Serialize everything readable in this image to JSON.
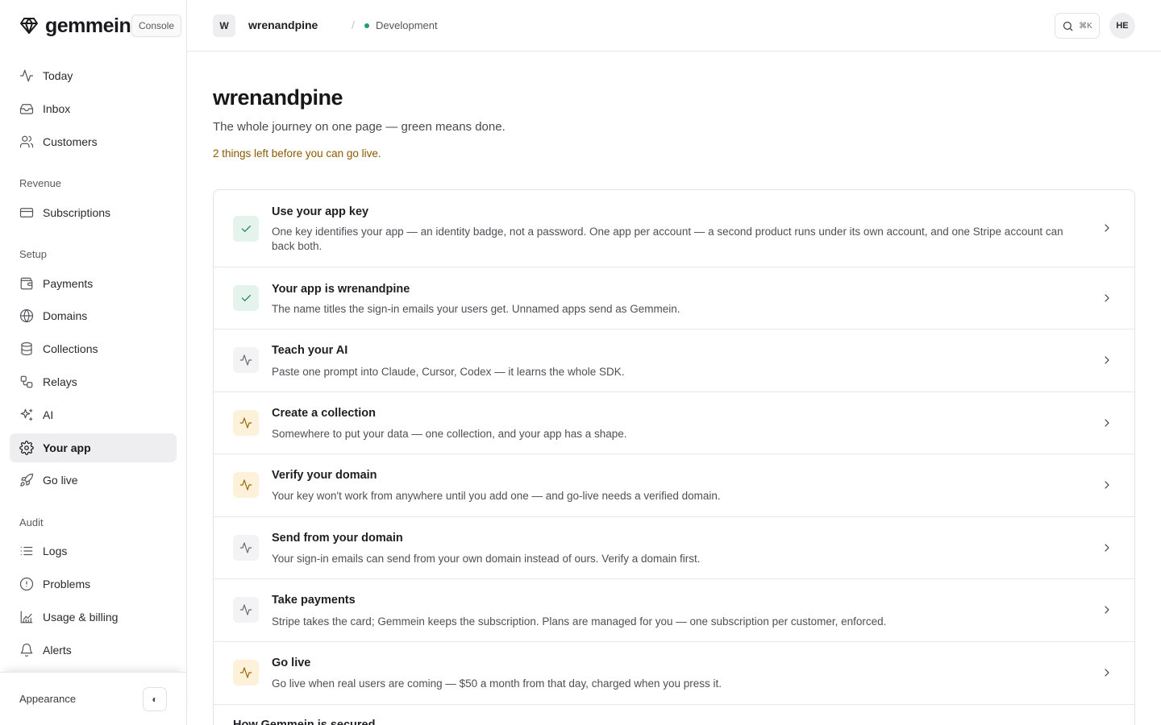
{
  "brand": {
    "name": "gemmein",
    "console_label": "Console"
  },
  "sidebar": {
    "primary": [
      {
        "label": "Today",
        "icon": "activity-icon"
      },
      {
        "label": "Inbox",
        "icon": "inbox-icon"
      },
      {
        "label": "Customers",
        "icon": "users-icon"
      }
    ],
    "sections": [
      {
        "label": "Revenue",
        "items": [
          {
            "label": "Subscriptions",
            "icon": "credit-card-icon"
          }
        ]
      },
      {
        "label": "Setup",
        "items": [
          {
            "label": "Payments",
            "icon": "wallet-icon"
          },
          {
            "label": "Domains",
            "icon": "globe-icon"
          },
          {
            "label": "Collections",
            "icon": "database-icon"
          },
          {
            "label": "Relays",
            "icon": "relay-icon"
          },
          {
            "label": "AI",
            "icon": "sparkles-icon"
          },
          {
            "label": "Your app",
            "icon": "gear-icon",
            "active": true
          },
          {
            "label": "Go live",
            "icon": "rocket-icon"
          }
        ]
      },
      {
        "label": "Audit",
        "items": [
          {
            "label": "Logs",
            "icon": "list-icon"
          },
          {
            "label": "Problems",
            "icon": "alert-circle-icon"
          },
          {
            "label": "Usage & billing",
            "icon": "chart-icon"
          },
          {
            "label": "Alerts",
            "icon": "bell-icon"
          }
        ]
      }
    ],
    "footer": {
      "appearance_label": "Appearance",
      "toggle_glyph": "◐"
    }
  },
  "topbar": {
    "app_initial": "W",
    "app_name": "wrenandpine",
    "separator": "/",
    "environment": "Development",
    "environment_color": "#1e9e6a",
    "search_shortcut": "⌘K",
    "user_initials": "HE"
  },
  "page": {
    "title": "wrenandpine",
    "subtitle": "The whole journey on one page — green means done.",
    "status": "2 things left before you can go live."
  },
  "steps": [
    {
      "state": "done",
      "title": "Use your app key",
      "description": "One key identifies your app — an identity badge, not a password. One app per account — a second product runs under its own account, and one Stripe account can back both."
    },
    {
      "state": "done",
      "title": "Your app is wrenandpine",
      "description": "The name titles the sign-in emails your users get. Unnamed apps send as Gemmein."
    },
    {
      "state": "todo",
      "title": "Teach your AI",
      "description": "Paste one prompt into Claude, Cursor, Codex — it learns the whole SDK."
    },
    {
      "state": "warn",
      "title": "Create a collection",
      "description": "Somewhere to put your data — one collection, and your app has a shape."
    },
    {
      "state": "warn",
      "title": "Verify your domain",
      "description": "Your key won't work from anywhere until you add one — and go-live needs a verified domain."
    },
    {
      "state": "todo",
      "title": "Send from your domain",
      "description": "Your sign-in emails can send from your own domain instead of ours. Verify a domain first."
    },
    {
      "state": "todo",
      "title": "Take payments",
      "description": "Stripe takes the card; Gemmein keeps the subscription. Plans are managed for you — one subscription per customer, enforced."
    },
    {
      "state": "warn",
      "title": "Go live",
      "description": "Go live when real users are coming — $50 a month from that day, charged when you press it."
    },
    {
      "state": "todo",
      "title": "How Gemmein is secured",
      "description": ""
    }
  ],
  "colors": {
    "done": "#1e7a52",
    "warn": "#9a6a10",
    "status_text": "#8a5a00"
  }
}
